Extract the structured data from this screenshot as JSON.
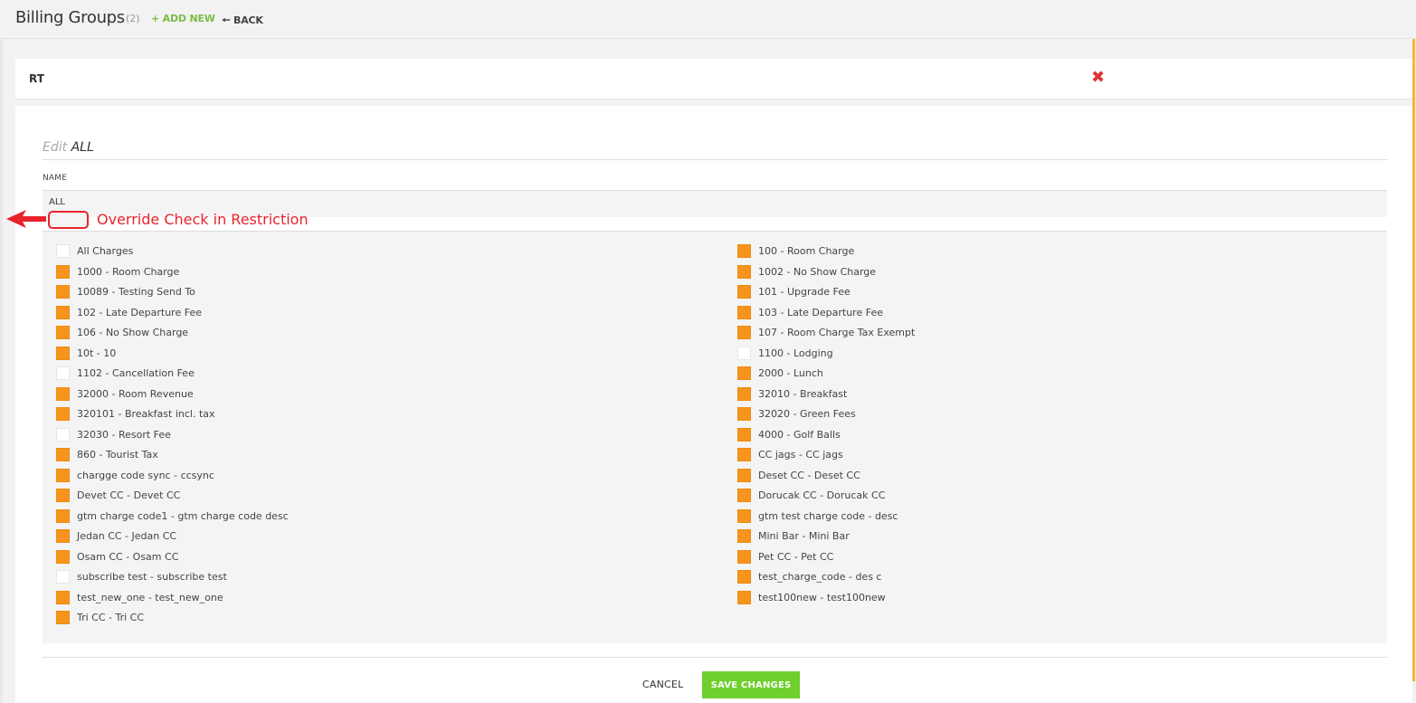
{
  "header": {
    "title": "Billing Groups",
    "count": "(2)",
    "add_new_label": "+ ADD NEW",
    "back_label": "🠔 BACK"
  },
  "group": {
    "name": "RT",
    "delete_icon": "close-icon"
  },
  "edit_form": {
    "title_prefix": "Edit",
    "title_name": "ALL",
    "name_label": "NAME",
    "name_value": "ALL",
    "annotation": "Override Check in Restriction",
    "cancel_label": "CANCEL",
    "save_label": "SAVE CHANGES"
  },
  "charges": {
    "left": [
      {
        "label": "All Charges",
        "checked": false
      },
      {
        "label": "1000 - Room Charge",
        "checked": true
      },
      {
        "label": "10089 - Testing Send To",
        "checked": true
      },
      {
        "label": "102 - Late Departure Fee",
        "checked": true
      },
      {
        "label": "106 - No Show Charge",
        "checked": true
      },
      {
        "label": "10t - 10",
        "checked": true
      },
      {
        "label": "1102 - Cancellation Fee",
        "checked": false
      },
      {
        "label": "32000 - Room Revenue",
        "checked": true
      },
      {
        "label": "320101 - Breakfast incl. tax",
        "checked": true
      },
      {
        "label": "32030 - Resort Fee",
        "checked": false
      },
      {
        "label": "860 - Tourist Tax",
        "checked": true
      },
      {
        "label": "chargge code sync - ccsync",
        "checked": true
      },
      {
        "label": "Devet CC - Devet CC",
        "checked": true
      },
      {
        "label": "gtm charge code1 - gtm charge code desc",
        "checked": true
      },
      {
        "label": "Jedan CC - Jedan CC",
        "checked": true
      },
      {
        "label": "Osam CC - Osam CC",
        "checked": true
      },
      {
        "label": "subscribe test - subscribe test",
        "checked": false
      },
      {
        "label": "test_new_one - test_new_one",
        "checked": true
      },
      {
        "label": "Tri CC - Tri CC",
        "checked": true
      }
    ],
    "right": [
      {
        "label": "100 - Room Charge",
        "checked": true
      },
      {
        "label": "1002 - No Show Charge",
        "checked": true
      },
      {
        "label": "101 - Upgrade Fee",
        "checked": true
      },
      {
        "label": "103 - Late Departure Fee",
        "checked": true
      },
      {
        "label": "107 - Room Charge Tax Exempt",
        "checked": true
      },
      {
        "label": "1100 - Lodging",
        "checked": false
      },
      {
        "label": "2000 - Lunch",
        "checked": true
      },
      {
        "label": "32010 - Breakfast",
        "checked": true
      },
      {
        "label": "32020 - Green Fees",
        "checked": true
      },
      {
        "label": "4000 - Golf Balls",
        "checked": true
      },
      {
        "label": "CC jags - CC jags",
        "checked": true
      },
      {
        "label": "Deset CC - Deset CC",
        "checked": true
      },
      {
        "label": "Dorucak CC - Dorucak CC",
        "checked": true
      },
      {
        "label": "gtm test charge code - desc",
        "checked": true
      },
      {
        "label": "Mini Bar - Mini Bar",
        "checked": true
      },
      {
        "label": "Pet CC - Pet CC",
        "checked": true
      },
      {
        "label": "test_charge_code - des c",
        "checked": true
      },
      {
        "label": "test100new - test100new",
        "checked": true
      }
    ]
  },
  "colors": {
    "accent_green": "#7bbd45",
    "save_button": "#6fcf2c",
    "checkbox_on": "#f7941d",
    "annotation_red": "#e8232a",
    "right_accent": "#f5b82e"
  }
}
